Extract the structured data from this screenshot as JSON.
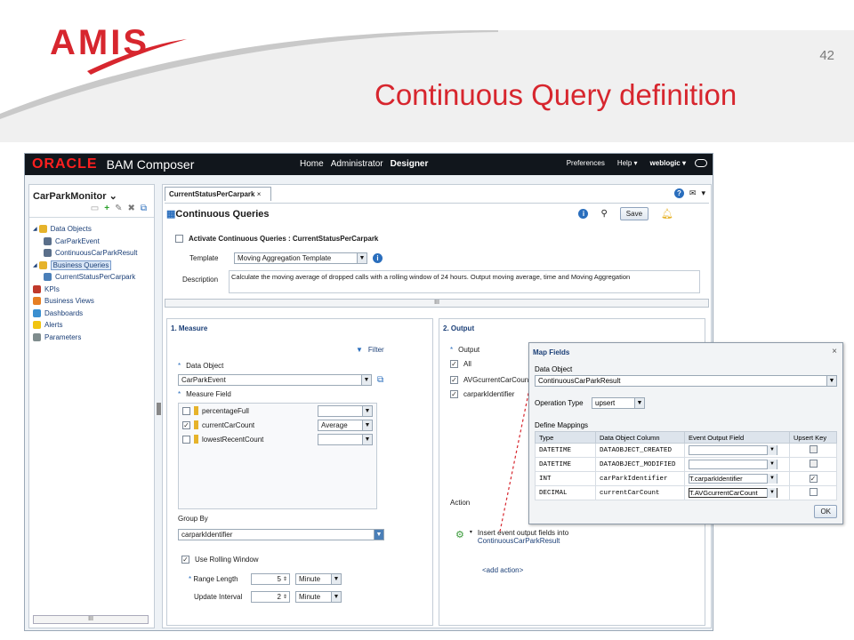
{
  "slide": {
    "logo": "AMIS",
    "page_number": "42",
    "title": "Continuous Query definition"
  },
  "colors": {
    "brand_red": "#d7262e",
    "topbar": "#11161c",
    "link_blue": "#1b3f77",
    "accent_blue": "#2a6ebd"
  },
  "app": {
    "vendor": "ORACLE",
    "name": "BAM Composer",
    "nav": {
      "home": "Home",
      "administrator": "Administrator",
      "designer": "Designer"
    },
    "top_right": {
      "preferences": "Preferences",
      "help": "Help ▾",
      "user": "weblogic ▾"
    }
  },
  "left_panel": {
    "title": "CarParkMonitor",
    "tree": [
      {
        "label": "Data Objects",
        "icon": "folder-icon"
      },
      {
        "label": "CarParkEvent",
        "icon": "data-object-icon"
      },
      {
        "label": "ContinuousCarParkResult",
        "icon": "data-object-icon"
      },
      {
        "label": "Business Queries",
        "icon": "folder-icon"
      },
      {
        "label": "CurrentStatusPerCarpark",
        "icon": "query-icon"
      },
      {
        "label": "KPIs",
        "icon": "kpi-icon"
      },
      {
        "label": "Business Views",
        "icon": "views-icon"
      },
      {
        "label": "Dashboards",
        "icon": "dashboard-icon"
      },
      {
        "label": "Alerts",
        "icon": "alert-icon"
      },
      {
        "label": "Parameters",
        "icon": "parameters-icon"
      }
    ],
    "scroll_label": "III"
  },
  "main": {
    "tab_label": "CurrentStatusPerCarpark",
    "section_title": "Continuous Queries",
    "save_label": "Save",
    "activate_label": "Activate Continuous Queries : CurrentStatusPerCarpark",
    "template_label": "Template",
    "template_value": "Moving Aggregation Template",
    "description_label": "Description",
    "description_value": "Calculate the moving average of dropped calls with a rolling window of 24 hours. Output moving average, time and Moving Aggregation",
    "hscroll_label": "III"
  },
  "measure": {
    "title": "1. Measure",
    "filter_label": "Filter",
    "data_object_label": "Data Object",
    "data_object_value": "CarParkEvent",
    "measure_field_label": "Measure Field",
    "fields": [
      {
        "name": "percentageFull",
        "checked": false,
        "agg": ""
      },
      {
        "name": "currentCarCount",
        "checked": true,
        "agg": "Average"
      },
      {
        "name": "lowestRecentCount",
        "checked": false,
        "agg": ""
      }
    ],
    "group_by_label": "Group By",
    "group_by_value": "carparkIdentifier",
    "rolling_label": "Use Rolling Window",
    "range_length_label": "Range Length",
    "range_length_value": "5",
    "range_unit": "Minute",
    "update_interval_label": "Update Interval",
    "update_interval_value": "2",
    "update_unit": "Minute"
  },
  "output": {
    "title": "2. Output",
    "output_label": "Output",
    "all_label": "All",
    "fields": [
      "AVGcurrentCarCount",
      "carparkIdentifier"
    ],
    "action_label": "Action",
    "action_text": "Insert event output fields into",
    "action_target": "ContinuousCarParkResult",
    "add_action": "<add action>"
  },
  "map_fields": {
    "title": "Map Fields",
    "data_object_label": "Data Object",
    "data_object_value": "ContinuousCarParkResult",
    "operation_type_label": "Operation Type",
    "operation_type_value": "upsert",
    "define_mappings_label": "Define Mappings",
    "columns": [
      "Type",
      "Data Object Column",
      "Event Output Field",
      "Upsert Key"
    ],
    "rows": [
      {
        "type": "DATETIME",
        "column": "DATAOBJECT_CREATED",
        "field": "",
        "upsert": false
      },
      {
        "type": "DATETIME",
        "column": "DATAOBJECT_MODIFIED",
        "field": "",
        "upsert": false
      },
      {
        "type": "INT",
        "column": "carParkIdentifier",
        "field": "T.carparkIdentifier",
        "upsert": true
      },
      {
        "type": "DECIMAL",
        "column": "currentCarCount",
        "field": "T.AVGcurrentCarCount",
        "upsert": false
      }
    ],
    "ok_label": "OK"
  }
}
